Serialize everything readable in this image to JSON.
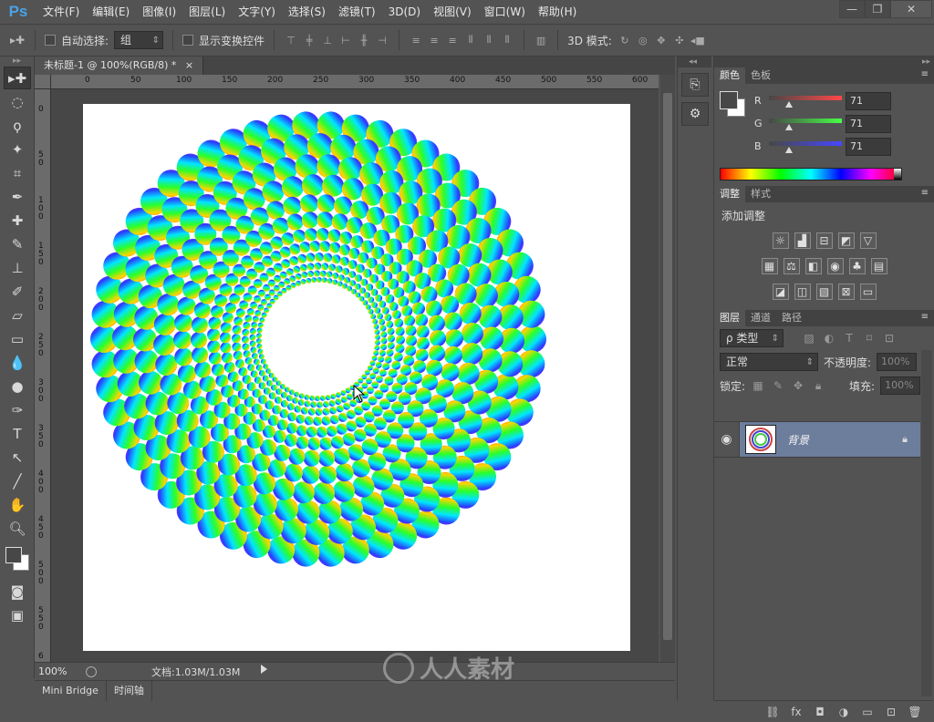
{
  "app": {
    "logo": "Ps"
  },
  "menu": [
    "文件(F)",
    "编辑(E)",
    "图像(I)",
    "图层(L)",
    "文字(Y)",
    "选择(S)",
    "滤镜(T)",
    "3D(D)",
    "视图(V)",
    "窗口(W)",
    "帮助(H)"
  ],
  "window_controls": {
    "minimize": "—",
    "restore": "❐",
    "close": "✕"
  },
  "options": {
    "auto_select_label": "自动选择:",
    "auto_select_value": "组",
    "show_transform_label": "显示变换控件",
    "mode_3d_label": "3D 模式:"
  },
  "document": {
    "tab_title": "未标题-1 @ 100%(RGB/8) *",
    "tab_close": "×",
    "ruler_h": [
      "0",
      "50",
      "100",
      "150",
      "200",
      "250",
      "300",
      "350",
      "400",
      "450",
      "500",
      "550",
      "600"
    ],
    "ruler_v": [
      "0",
      "50",
      "100",
      "150",
      "200",
      "250",
      "300",
      "350",
      "400",
      "450",
      "500",
      "550",
      "6"
    ],
    "zoom": "100%",
    "doc_info": "文档:1.03M/1.03M"
  },
  "bottom_tabs": [
    "Mini Bridge",
    "时间轴"
  ],
  "color_panel": {
    "tabs": [
      "颜色",
      "色板"
    ],
    "r_label": "R",
    "g_label": "G",
    "b_label": "B",
    "r": "71",
    "g": "71",
    "b": "71",
    "r_fraction": 0.278,
    "g_fraction": 0.278,
    "b_fraction": 0.278,
    "fg_color": "#474747",
    "bg_color": "#ffffff"
  },
  "adjust_panel": {
    "tabs": [
      "调整",
      "样式"
    ],
    "title": "添加调整",
    "row1": [
      "☼",
      "▟",
      "⊟",
      "◩",
      "▽"
    ],
    "row2": [
      "▦",
      "⚖",
      "◧",
      "◉",
      "♣",
      "▤"
    ],
    "row3": [
      "◪",
      "◫",
      "▧",
      "⊠",
      "▭"
    ]
  },
  "layers_panel": {
    "tabs": [
      "图层",
      "通道",
      "路径"
    ],
    "kind_label": "ρ 类型",
    "blend_mode": "正常",
    "opacity_label": "不透明度:",
    "opacity_value": "100%",
    "lock_label": "锁定:",
    "fill_label": "填充:",
    "fill_value": "100%",
    "layer_name": "背景",
    "footer": [
      "⛓",
      "fx",
      "◘",
      "◑",
      "▭",
      "⊡",
      "🗑"
    ]
  },
  "watermark": "人人素材"
}
